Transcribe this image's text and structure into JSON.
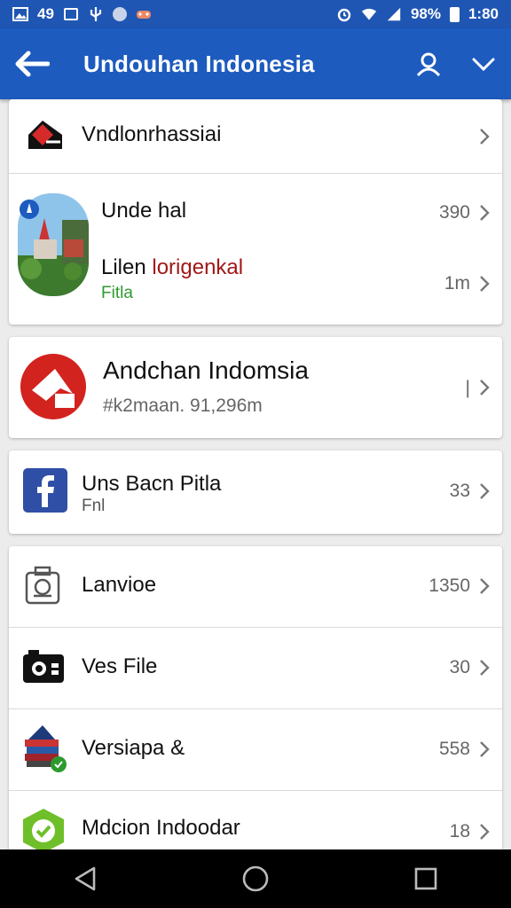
{
  "status_bar": {
    "left_text": "49",
    "battery_text": "98%",
    "time": "1:80"
  },
  "app_bar": {
    "title": "Undouhan Indonesia"
  },
  "items": [
    {
      "title": "Vndlonrhassiai"
    },
    {
      "title": "Unde hal",
      "meta": "390"
    },
    {
      "title": "Lilen ",
      "title_highlight": "lorigenkal",
      "sub": "Fitla",
      "meta": "1m"
    },
    {
      "title": "Andchan Indomsia",
      "sub": "#k2maan. 91,296m",
      "meta": "|"
    },
    {
      "title": "Uns Bacn Pitla",
      "sub": "Fnl",
      "meta": "33"
    },
    {
      "title": "Lanvioe",
      "meta": "1350"
    },
    {
      "title": "Ves File",
      "meta": "30"
    },
    {
      "title": "Versiapa &",
      "meta": "558"
    },
    {
      "title": "Mdcion Indoodar",
      "meta": "18"
    }
  ],
  "colors": {
    "primary": "#1d5bbf",
    "status_bar": "#1f56b3",
    "highlight_red": "#a01818",
    "sub_green": "#2e9a2e"
  }
}
